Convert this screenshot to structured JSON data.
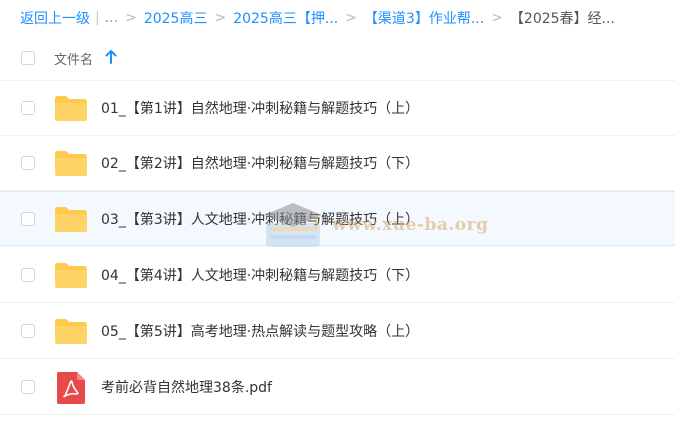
{
  "breadcrumb": {
    "back": "返回上一级",
    "ellipsis": "...",
    "items": [
      "2025高三",
      "2025高三【押...",
      "【渠道3】作业帮...",
      "【2025春】经..."
    ]
  },
  "header": {
    "column_label": "文件名"
  },
  "files": [
    {
      "name": "01_【第1讲】自然地理·冲刺秘籍与解题技巧（上）",
      "type": "folder"
    },
    {
      "name": "02_【第2讲】自然地理·冲刺秘籍与解题技巧（下）",
      "type": "folder"
    },
    {
      "name": "03_【第3讲】人文地理·冲刺秘籍与解题技巧（上）",
      "type": "folder"
    },
    {
      "name": "04_【第4讲】人文地理·冲刺秘籍与解题技巧（下）",
      "type": "folder"
    },
    {
      "name": "05_【第5讲】高考地理·热点解读与题型攻略（上）",
      "type": "folder"
    },
    {
      "name": "考前必背自然地理38条.pdf",
      "type": "pdf"
    }
  ],
  "watermark": {
    "text": "www.xue-ba.org"
  },
  "colors": {
    "link": "#1e90ff",
    "folder": "#ffc94d",
    "pdf": "#e84a4a"
  }
}
